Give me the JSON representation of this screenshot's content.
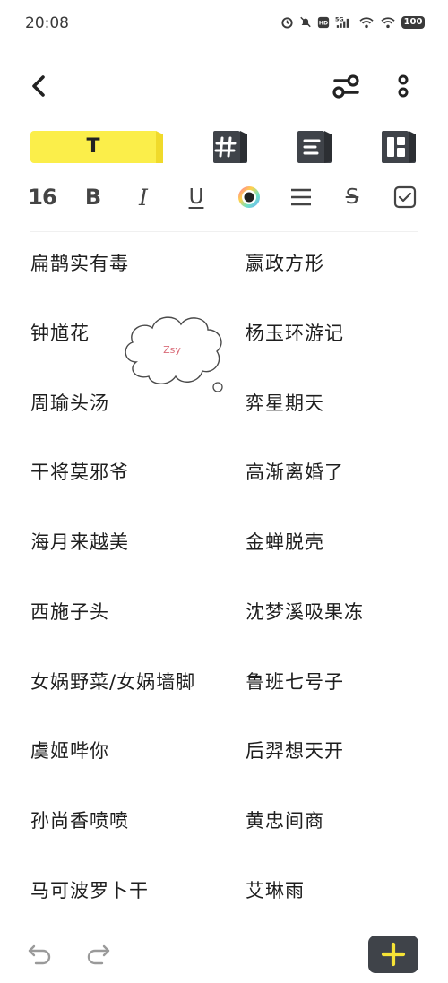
{
  "status": {
    "time": "20:08",
    "battery": "100",
    "signal_label": "5G"
  },
  "toolbar_tabs": [
    {
      "name": "text-tab",
      "label": "T",
      "active": true
    },
    {
      "name": "hashtag-tab",
      "icon": "hashtag-icon"
    },
    {
      "name": "list-tab",
      "icon": "list-icon"
    },
    {
      "name": "layout-tab",
      "icon": "layout-icon"
    }
  ],
  "format": {
    "size": "16",
    "bold": "B",
    "italic": "I",
    "underline": "U",
    "color_accent": "#222222",
    "strike": "S"
  },
  "items": [
    {
      "left": "扁鹊实有毒",
      "right": "嬴政方形"
    },
    {
      "left": "钟馗花",
      "right": "杨玉环游记"
    },
    {
      "left": "周瑜头汤",
      "right": "弈星期天"
    },
    {
      "left": "干将莫邪爷",
      "right": "高渐离婚了"
    },
    {
      "left": "海月来越美",
      "right": "金蝉脱壳"
    },
    {
      "left": "西施子头",
      "right": "沈梦溪吸果冻"
    },
    {
      "left": "女娲野菜/女娲墙脚",
      "right": "鲁班七号子"
    },
    {
      "left": "虞姬哔你",
      "right": "后羿想天开"
    },
    {
      "left": "孙尚香喷喷",
      "right": "黄忠间商"
    },
    {
      "left": "马可波罗卜干",
      "right": "艾琳雨"
    }
  ],
  "sticker": {
    "text": "Zsy"
  },
  "colors": {
    "accent_yellow": "#fbee4a",
    "dark_button": "#3f4349",
    "plus_yellow": "#f6e336"
  }
}
